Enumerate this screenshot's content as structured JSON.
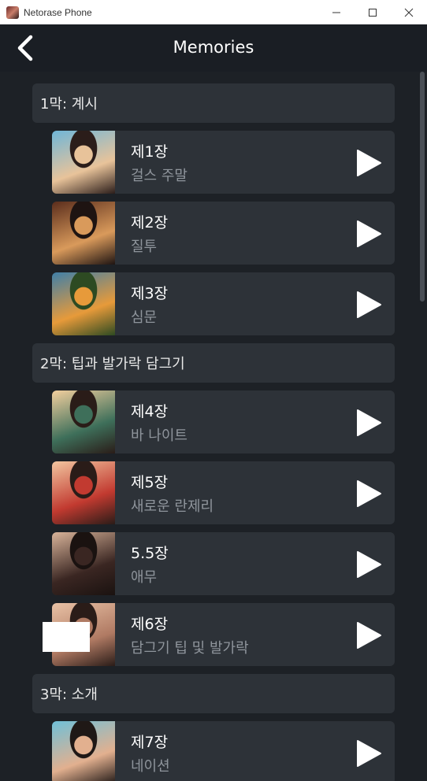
{
  "window": {
    "title": "Netorase Phone",
    "minimize_glyph": "─",
    "maximize_glyph": "☐",
    "close_glyph": "✕"
  },
  "header": {
    "title": "Memories",
    "back_icon": "chevron-left-icon"
  },
  "colors": {
    "background": "#1d2126",
    "card": "#2d3238",
    "title": "#ffffff",
    "subtitle": "#8f959c"
  },
  "acts": [
    {
      "label": "1막: 계시",
      "chapters": [
        {
          "title": "제1장",
          "subtitle": "걸스 주말",
          "thumb": [
            "#6fb6d8",
            "#e8c39a",
            "#2b1d1a"
          ]
        },
        {
          "title": "제2장",
          "subtitle": "질투",
          "thumb": [
            "#5a2d1c",
            "#d99a5b",
            "#1e1412"
          ]
        },
        {
          "title": "제3장",
          "subtitle": "심문",
          "thumb": [
            "#3f7fa8",
            "#e79a3a",
            "#2d4a22"
          ]
        }
      ]
    },
    {
      "label": "2막: 팁과 발가락 담그기",
      "chapters": [
        {
          "title": "제4장",
          "subtitle": "바 나이트",
          "thumb": [
            "#f3cf9e",
            "#3e6f5a",
            "#2a1c18"
          ]
        },
        {
          "title": "제5장",
          "subtitle": "새로운 란제리",
          "thumb": [
            "#f2c6a0",
            "#c23a30",
            "#2a1c18"
          ]
        },
        {
          "title": "5.5장",
          "subtitle": "애무",
          "thumb": [
            "#d9b49a",
            "#3a2622",
            "#1a1210"
          ]
        },
        {
          "title": "제6장",
          "subtitle": "담그기 팁 및 발가락",
          "thumb": [
            "#e9c2a6",
            "#b07a63",
            "#2a1c18"
          ]
        }
      ]
    },
    {
      "label": "3막: 소개",
      "chapters": [
        {
          "title": "제7장",
          "subtitle": "네이션",
          "thumb": [
            "#6fc0d8",
            "#e2b08f",
            "#1f1816"
          ]
        }
      ]
    }
  ]
}
